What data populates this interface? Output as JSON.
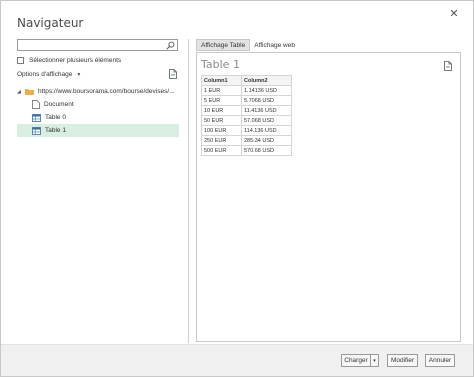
{
  "window": {
    "title": "Navigateur",
    "close_glyph": "✕"
  },
  "left_panel": {
    "search": {
      "value": "",
      "placeholder": ""
    },
    "multi_select_label": "Sélectionner plusieurs éléments",
    "view_options_label": "Options d'affichage",
    "tree": {
      "root_label": "https://www.boursorama.com/bourse/devises/...",
      "children": [
        {
          "label": "Document",
          "icon": "document-icon",
          "selected": false
        },
        {
          "label": "Table 0",
          "icon": "table-icon",
          "selected": false
        },
        {
          "label": "Table 1",
          "icon": "table-icon",
          "selected": true
        }
      ]
    }
  },
  "right_panel": {
    "tabs": [
      {
        "label": "Affichage Table",
        "active": true
      },
      {
        "label": "Affichage web",
        "active": false
      }
    ],
    "preview_title": "Table 1",
    "table": {
      "columns": [
        "Column1",
        "Column2"
      ],
      "rows": [
        [
          "1 EUR",
          "1.14136 USD"
        ],
        [
          "5 EUR",
          "5.7068 USD"
        ],
        [
          "10 EUR",
          "11.4136 USD"
        ],
        [
          "50 EUR",
          "57.068 USD"
        ],
        [
          "100 EUR",
          "114.136 USD"
        ],
        [
          "250 EUR",
          "285.34 USD"
        ],
        [
          "500 EUR",
          "570.68 USD"
        ]
      ]
    }
  },
  "footer": {
    "load_label": "Charger",
    "load_arrow": "▾",
    "edit_label": "Modifier",
    "cancel_label": "Annuler"
  },
  "colors": {
    "selected_row": "#d7eee1",
    "folder": "#e8b04a",
    "table_icon": "#3a6ea5"
  }
}
